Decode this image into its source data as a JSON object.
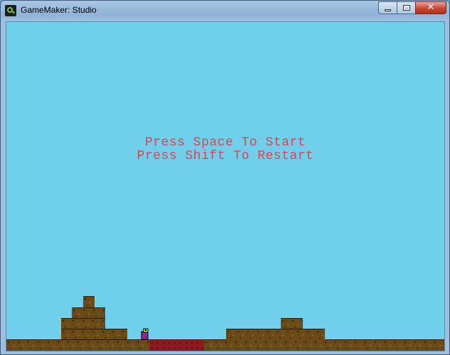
{
  "window": {
    "title": "GameMaker: Studio",
    "controls": {
      "minimize": "—",
      "maximize": "□",
      "close": "✕"
    }
  },
  "game": {
    "messages": [
      "Press Space To Start",
      "Press Shift To Restart"
    ],
    "colors": {
      "sky": "#70cfea",
      "text": "#d6474e",
      "dirt": "#6a4a16",
      "lava": "#8c1a1e",
      "player": "#8a2b8f"
    },
    "icons": [
      "app-icon",
      "minimize-icon",
      "maximize-icon",
      "close-icon"
    ]
  }
}
